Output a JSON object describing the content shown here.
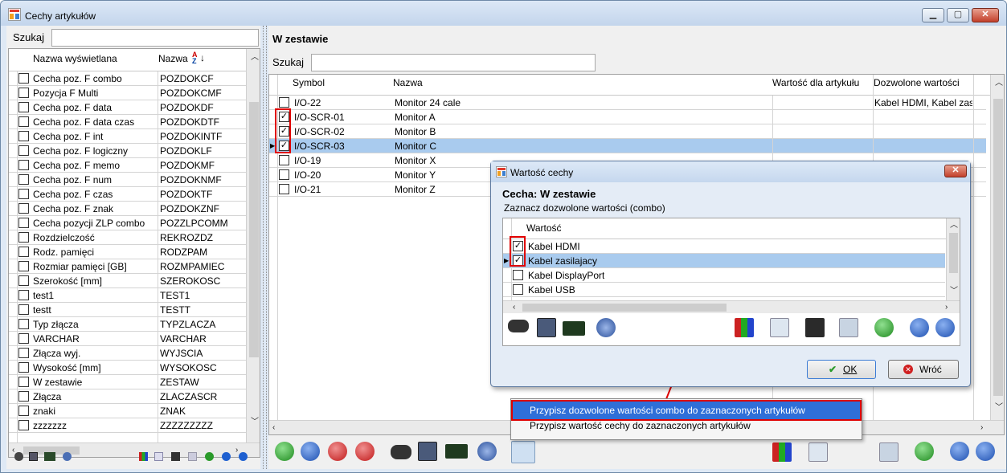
{
  "window": {
    "title": "Cechy artykułów",
    "minimize": "▁",
    "maximize": "▢",
    "close": "✕"
  },
  "left": {
    "search_label": "Szukaj",
    "search_value": "",
    "col_name": "Nazwa wyświetlana",
    "col_code": "Nazwa",
    "rows": [
      {
        "name": "Cecha poz. F combo",
        "code": "POZDOKCF"
      },
      {
        "name": "Pozycja F Multi",
        "code": "POZDOKCMF"
      },
      {
        "name": "Cecha poz. F data",
        "code": "POZDOKDF"
      },
      {
        "name": "Cecha poz. F data czas",
        "code": "POZDOKDTF"
      },
      {
        "name": "Cecha poz. F int",
        "code": "POZDOKINTF"
      },
      {
        "name": "Cecha poz. F logiczny",
        "code": "POZDOKLF"
      },
      {
        "name": "Cecha poz. F memo",
        "code": "POZDOKMF"
      },
      {
        "name": "Cecha poz. F num",
        "code": "POZDOKNMF"
      },
      {
        "name": "Cecha poz. F czas",
        "code": "POZDOKTF"
      },
      {
        "name": "Cecha poz. F znak",
        "code": "POZDOKZNF"
      },
      {
        "name": "Cecha pozycji ZLP combo",
        "code": "POZZLPCOMM"
      },
      {
        "name": "Rozdzielczość",
        "code": "REKROZDZ"
      },
      {
        "name": "Rodz. pamięci",
        "code": "RODZPAM"
      },
      {
        "name": "Rozmiar pamięci [GB]",
        "code": "ROZMPAMIEC"
      },
      {
        "name": "Szerokość [mm]",
        "code": "SZEROKOSC"
      },
      {
        "name": "test1",
        "code": "TEST1"
      },
      {
        "name": "testt",
        "code": "TESTT"
      },
      {
        "name": "Typ złącza",
        "code": "TYPZLACZA"
      },
      {
        "name": "VARCHAR",
        "code": "VARCHAR"
      },
      {
        "name": "Złącza wyj.",
        "code": "WYJSCIA"
      },
      {
        "name": "Wysokość [mm]",
        "code": "WYSOKOSC"
      },
      {
        "name": "W zestawie",
        "code": "ZESTAW"
      },
      {
        "name": "Złącza",
        "code": "ZLACZASCR"
      },
      {
        "name": "znaki",
        "code": "ZNAK"
      },
      {
        "name": "zzzzzzz",
        "code": "ZZZZZZZZZ"
      }
    ]
  },
  "right": {
    "section_title": "W zestawie",
    "search_label": "Szukaj",
    "search_value": "",
    "col_symbol": "Symbol",
    "col_name": "Nazwa",
    "col_value": "Wartość dla artykułu",
    "col_allowed": "Dozwolone wartości",
    "rows": [
      {
        "symbol": "I/O-22",
        "name": "Monitor 24 cale",
        "value": "",
        "allowed": "Kabel HDMI, Kabel zas",
        "checked": false
      },
      {
        "symbol": "I/O-SCR-01",
        "name": "Monitor A",
        "value": "",
        "allowed": "",
        "checked": true
      },
      {
        "symbol": "I/O-SCR-02",
        "name": "Monitor B",
        "value": "",
        "allowed": "",
        "checked": true
      },
      {
        "symbol": "I/O-SCR-03",
        "name": "Monitor C",
        "value": "",
        "allowed": "",
        "checked": true
      },
      {
        "symbol": "I/O-19",
        "name": "Monitor X",
        "value": "",
        "allowed": "",
        "checked": false
      },
      {
        "symbol": "I/O-20",
        "name": "Monitor Y",
        "value": "",
        "allowed": "",
        "checked": false
      },
      {
        "symbol": "I/O-21",
        "name": "Monitor Z",
        "value": "",
        "allowed": "",
        "checked": false
      }
    ]
  },
  "dialog": {
    "title": "Wartość cechy",
    "close": "✕",
    "heading": "Cecha: W zestawie",
    "subheading": "Zaznacz dozwolone wartości (combo)",
    "col_value": "Wartość",
    "items": [
      {
        "label": "Kabel HDMI",
        "checked": true
      },
      {
        "label": "Kabel zasilajacy",
        "checked": true
      },
      {
        "label": "Kabel DisplayPort",
        "checked": false
      },
      {
        "label": "Kabel USB",
        "checked": false
      }
    ],
    "ok_label": "OK",
    "cancel_label": "Wróć"
  },
  "context_menu": {
    "item1": "Przypisz dozwolone wartości combo do zaznaczonych artykułów",
    "item2": "Przypisz wartość cechy do zaznaczonych artykułów"
  },
  "colors": {
    "selection": "#a9cbee",
    "highlight_box": "#e00000",
    "menu_selection": "#2f6fd8"
  }
}
